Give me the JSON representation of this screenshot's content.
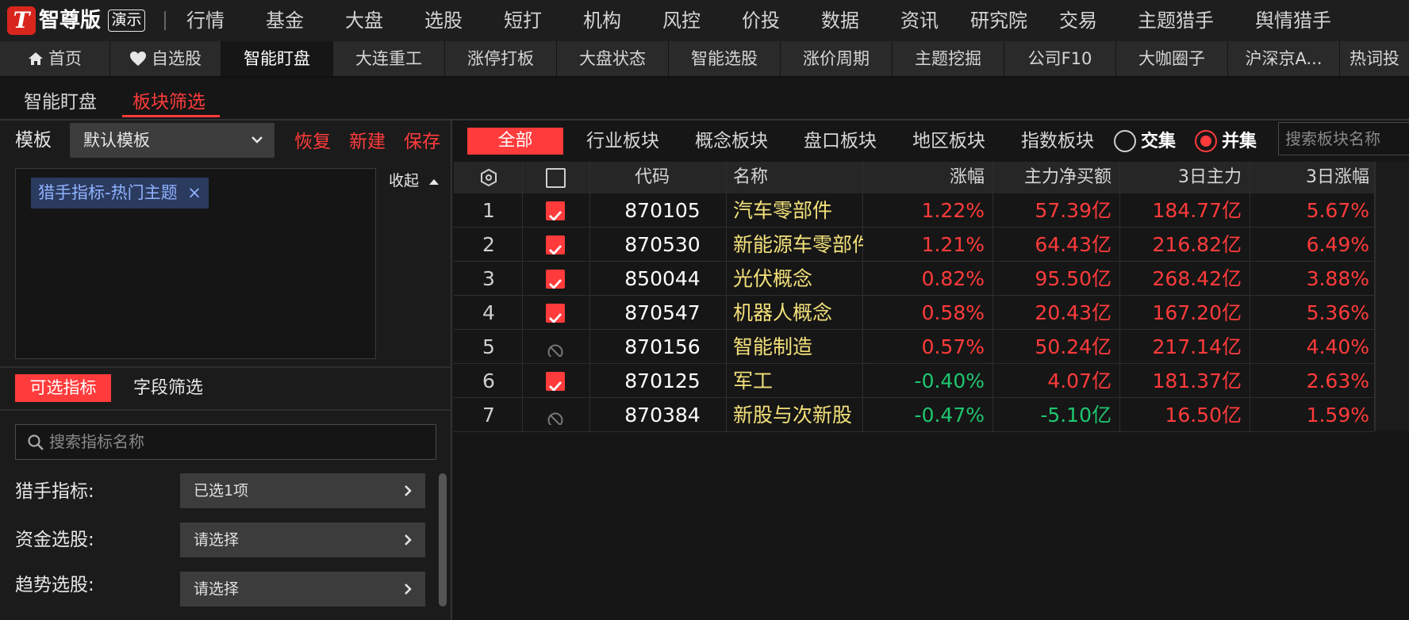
{
  "app": {
    "logo_glyph": "T",
    "brand": "智尊版",
    "demo_badge": "演示"
  },
  "top_menu": [
    "行情",
    "基金",
    "大盘",
    "选股",
    "短打",
    "机构",
    "风控",
    "价投",
    "数据",
    "资讯",
    "研究院",
    "交易",
    "主题猎手",
    "舆情猎手"
  ],
  "tabs": [
    {
      "label": "首页",
      "icon": "home-icon"
    },
    {
      "label": "自选股",
      "icon": "heart-icon"
    },
    {
      "label": "智能盯盘",
      "active": true
    },
    {
      "label": "大连重工"
    },
    {
      "label": "涨停打板"
    },
    {
      "label": "大盘状态"
    },
    {
      "label": "智能选股"
    },
    {
      "label": "涨价周期"
    },
    {
      "label": "主题挖掘"
    },
    {
      "label": "公司F10"
    },
    {
      "label": "大咖圈子"
    },
    {
      "label": "沪深京A..."
    },
    {
      "label": "热词投"
    }
  ],
  "sub_tabs": [
    "智能盯盘",
    "板块筛选"
  ],
  "left": {
    "template_label": "模板",
    "template_value": "默认模板",
    "restore": "恢复",
    "create": "新建",
    "save": "保存",
    "tag": "猎手指标-热门主题",
    "tag_close": "×",
    "collapse": "收起",
    "active_tab": "可选指标",
    "field_filter": "字段筛选",
    "search_placeholder": "搜索指标名称",
    "filters": [
      {
        "label": "猎手指标:",
        "value": "已选1项"
      },
      {
        "label": "资金选股:",
        "value": "请选择"
      },
      {
        "label": "趋势选股:",
        "value": "请选择"
      }
    ]
  },
  "right": {
    "all": "全部",
    "categories": [
      "行业板块",
      "概念板块",
      "盘口板块",
      "地区板块",
      "指数板块"
    ],
    "intersect": "交集",
    "union": "并集",
    "union_selected": true,
    "search_placeholder": "搜索板块名称",
    "headers": [
      "代码",
      "名称",
      "涨幅",
      "主力净买额",
      "3日主力",
      "3日涨幅"
    ],
    "rows": [
      {
        "idx": "1",
        "checked": true,
        "code": "870105",
        "name": "汽车零部件",
        "pct": "1.22%",
        "amt": "57.39亿",
        "m3": "184.77亿",
        "p3": "5.67%"
      },
      {
        "idx": "2",
        "checked": true,
        "code": "870530",
        "name": "新能源车零部件",
        "pct": "1.21%",
        "amt": "64.43亿",
        "m3": "216.82亿",
        "p3": "6.49%"
      },
      {
        "idx": "3",
        "checked": true,
        "code": "850044",
        "name": "光伏概念",
        "pct": "0.82%",
        "amt": "95.50亿",
        "m3": "268.42亿",
        "p3": "3.88%"
      },
      {
        "idx": "4",
        "checked": true,
        "code": "870547",
        "name": "机器人概念",
        "pct": "0.58%",
        "amt": "20.43亿",
        "m3": "167.20亿",
        "p3": "5.36%"
      },
      {
        "idx": "5",
        "checked": false,
        "code": "870156",
        "name": "智能制造",
        "pct": "0.57%",
        "amt": "50.24亿",
        "m3": "217.14亿",
        "p3": "4.40%"
      },
      {
        "idx": "6",
        "checked": true,
        "code": "870125",
        "name": "军工",
        "pct": "-0.40%",
        "amt": "4.07亿",
        "m3": "181.37亿",
        "p3": "2.63%"
      },
      {
        "idx": "7",
        "checked": false,
        "code": "870384",
        "name": "新股与次新股",
        "pct": "-0.47%",
        "amt": "-5.10亿",
        "m3": "16.50亿",
        "p3": "1.59%"
      }
    ]
  },
  "colors": {
    "accent": "#ff3b3b",
    "up": "#ff3b3b",
    "down": "#1ec66f",
    "name": "#f3e07a",
    "tag_bg": "#2b3a5f",
    "tag_text": "#8fb3ff"
  }
}
